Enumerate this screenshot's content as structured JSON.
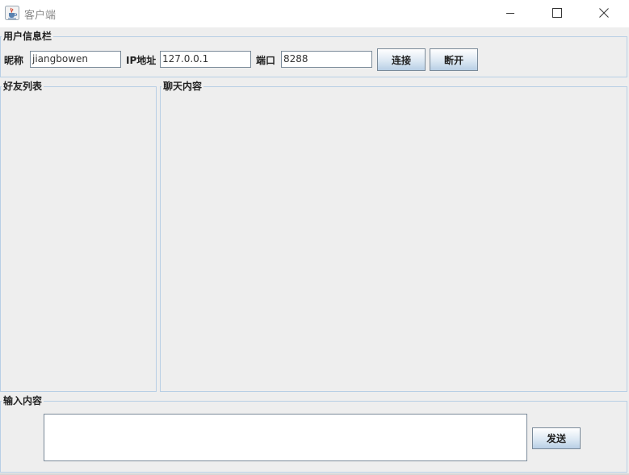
{
  "window": {
    "title": "客户端",
    "icon": "java-cup-icon",
    "controls": [
      "minimize-icon",
      "maximize-icon",
      "close-icon"
    ]
  },
  "user_info": {
    "legend": "用户信息栏",
    "nickname_label": "昵称",
    "nickname_value": "jiangbowen",
    "ip_label": "IP地址",
    "ip_value": "127.0.0.1",
    "port_label": "端口",
    "port_value": "8288",
    "connect_label": "连接",
    "disconnect_label": "断开"
  },
  "friends": {
    "legend": "好友列表",
    "items": []
  },
  "chat": {
    "legend": "聊天内容",
    "messages": []
  },
  "input": {
    "legend": "输入内容",
    "value": "",
    "send_label": "发送"
  },
  "colors": {
    "window_bg": "#eeeeee",
    "border": "#b8cfe5",
    "button_gradient_bottom": "#b8cfe5"
  }
}
